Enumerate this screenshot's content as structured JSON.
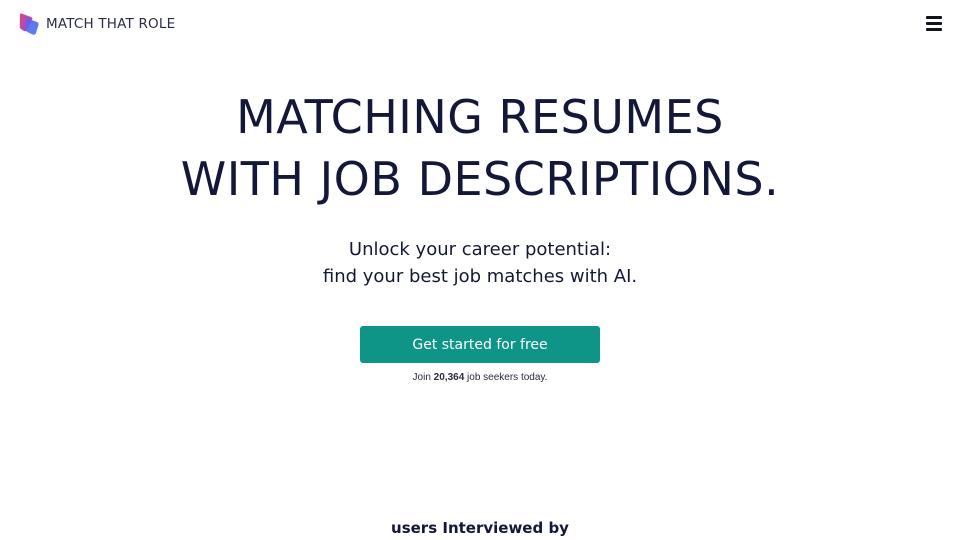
{
  "header": {
    "brand_name": "MATCH THAT ROLE",
    "logo_icon": "match-that-role-logo",
    "menu_icon": "hamburger-menu-icon"
  },
  "hero": {
    "title_line1": "MATCHING RESUMES",
    "title_line2": "WITH JOB DESCRIPTIONS.",
    "subtitle_line1": "Unlock your career potential:",
    "subtitle_line2": "find your best job matches with AI.",
    "cta_label": "Get started for free",
    "proof_prefix": "Join",
    "proof_count": "20,364",
    "proof_suffix": "job seekers today."
  },
  "section": {
    "interviewed_label": "users Interviewed by"
  },
  "colors": {
    "accent": "#0f9488",
    "text": "#141838",
    "logo_blue": "#4b6bf0",
    "logo_pink": "#e0457f"
  }
}
